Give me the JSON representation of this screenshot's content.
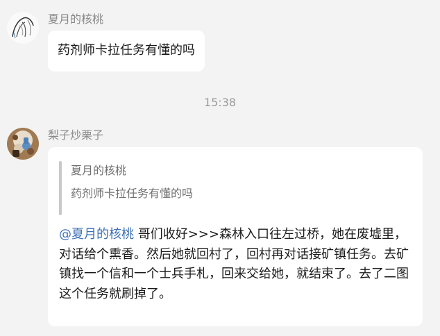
{
  "messages": [
    {
      "sender": "夏月的核桃",
      "text": "药剂师卡拉任务有懂的吗"
    },
    {
      "sender": "梨子炒栗子",
      "quote": {
        "sender": "夏月的核桃",
        "text": "药剂师卡拉任务有懂的吗"
      },
      "mention": "@夏月的核桃",
      "body": " 哥们收好>>>森林入口往左过桥，她在废墟里，对话给个熏香。然后她就回村了，回村再对话接矿镇任务。去矿镇找一个信和一个士兵手札，回来交给她，就结束了。去了二图这个任务就刷掉了。"
    }
  ],
  "timestamp": "15:38",
  "colors": {
    "background": "#f3f3f3",
    "bubble": "#ffffff",
    "mention": "#3d6fb5",
    "meta_text": "#8a8a8a"
  }
}
